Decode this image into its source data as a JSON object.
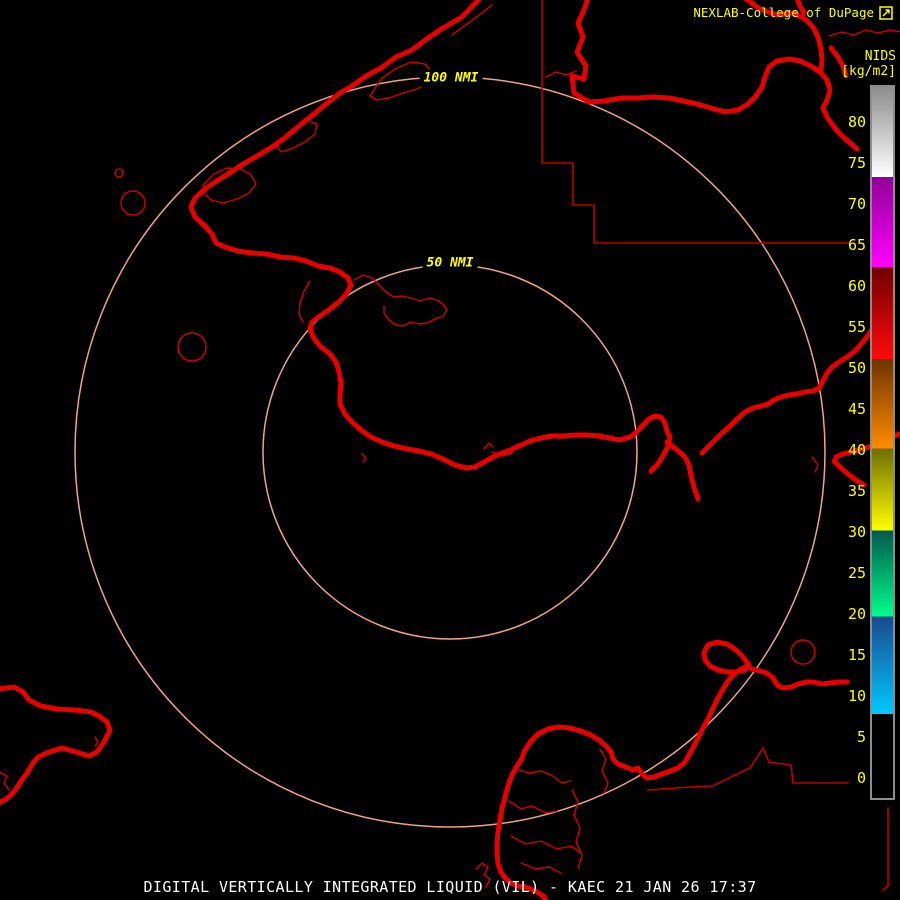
{
  "header": {
    "brand": "NEXLAB-College of DuPage"
  },
  "scale": {
    "title": "NIDS",
    "units": "[kg/m2]",
    "ticks": [
      80,
      75,
      70,
      65,
      60,
      55,
      50,
      45,
      40,
      35,
      30,
      25,
      20,
      15,
      10,
      5,
      0
    ],
    "segments": [
      {
        "from": 84.3,
        "to": 73.3,
        "c1": "#8C8C8C",
        "c2": "#FFFFFF"
      },
      {
        "from": 73.3,
        "to": 62.3,
        "c1": "#8F0096",
        "c2": "#FF00FF"
      },
      {
        "from": 62.3,
        "to": 51.1,
        "c1": "#6E0000",
        "c2": "#FF0A0A"
      },
      {
        "from": 51.1,
        "to": 40.2,
        "c1": "#6E3200",
        "c2": "#FF8C00"
      },
      {
        "from": 40.2,
        "to": 30.2,
        "c1": "#6E6E00",
        "c2": "#FFFF00"
      },
      {
        "from": 30.2,
        "to": 19.7,
        "c1": "#00584C",
        "c2": "#00FF8C"
      },
      {
        "from": 19.7,
        "to": 7.8,
        "c1": "#1A4A8C",
        "c2": "#00C8FF"
      },
      {
        "from": 7.8,
        "to": -2.7,
        "c1": "#000000",
        "c2": "#000000"
      }
    ]
  },
  "rings": {
    "inner_label": "50 NMI",
    "outer_label": "100 NMI"
  },
  "footer": {
    "title": "DIGITAL VERTICALLY INTEGRATED LIQUID (VIL) - KAEC 21 JAN 26 17:37"
  },
  "colors": {
    "background": "#000000",
    "map_line": "#E60000",
    "thin_line": "#D40000",
    "boundary_line": "#BE0000",
    "range_ring": "#F0A488",
    "label_yellow": "#FFFF00",
    "title_white": "#FFFFFF",
    "bar_border": "#8C8C8C"
  }
}
